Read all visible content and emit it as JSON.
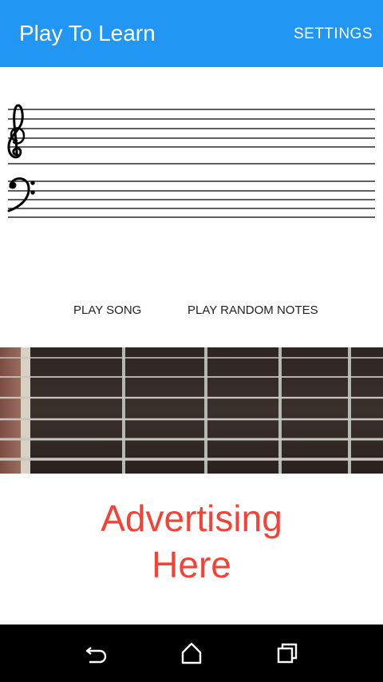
{
  "app_bar": {
    "title": "Play To Learn",
    "settings_label": "SETTINGS",
    "color": "#2196f3"
  },
  "staff": {
    "clefs": [
      "treble-clef",
      "bass-clef"
    ],
    "treble_glyph": "𝄞",
    "bass_glyph": "𝄢"
  },
  "actions": {
    "play_song_label": "PLAY SONG",
    "play_random_label": "PLAY RANDOM NOTES"
  },
  "fretboard": {
    "image": "guitar-fretboard",
    "string_count": 6
  },
  "advertising": {
    "line1": "Advertising",
    "line2": "Here",
    "color": "#f44336"
  },
  "nav_bar": {
    "icons": [
      "back-icon",
      "home-icon",
      "recents-icon"
    ]
  }
}
